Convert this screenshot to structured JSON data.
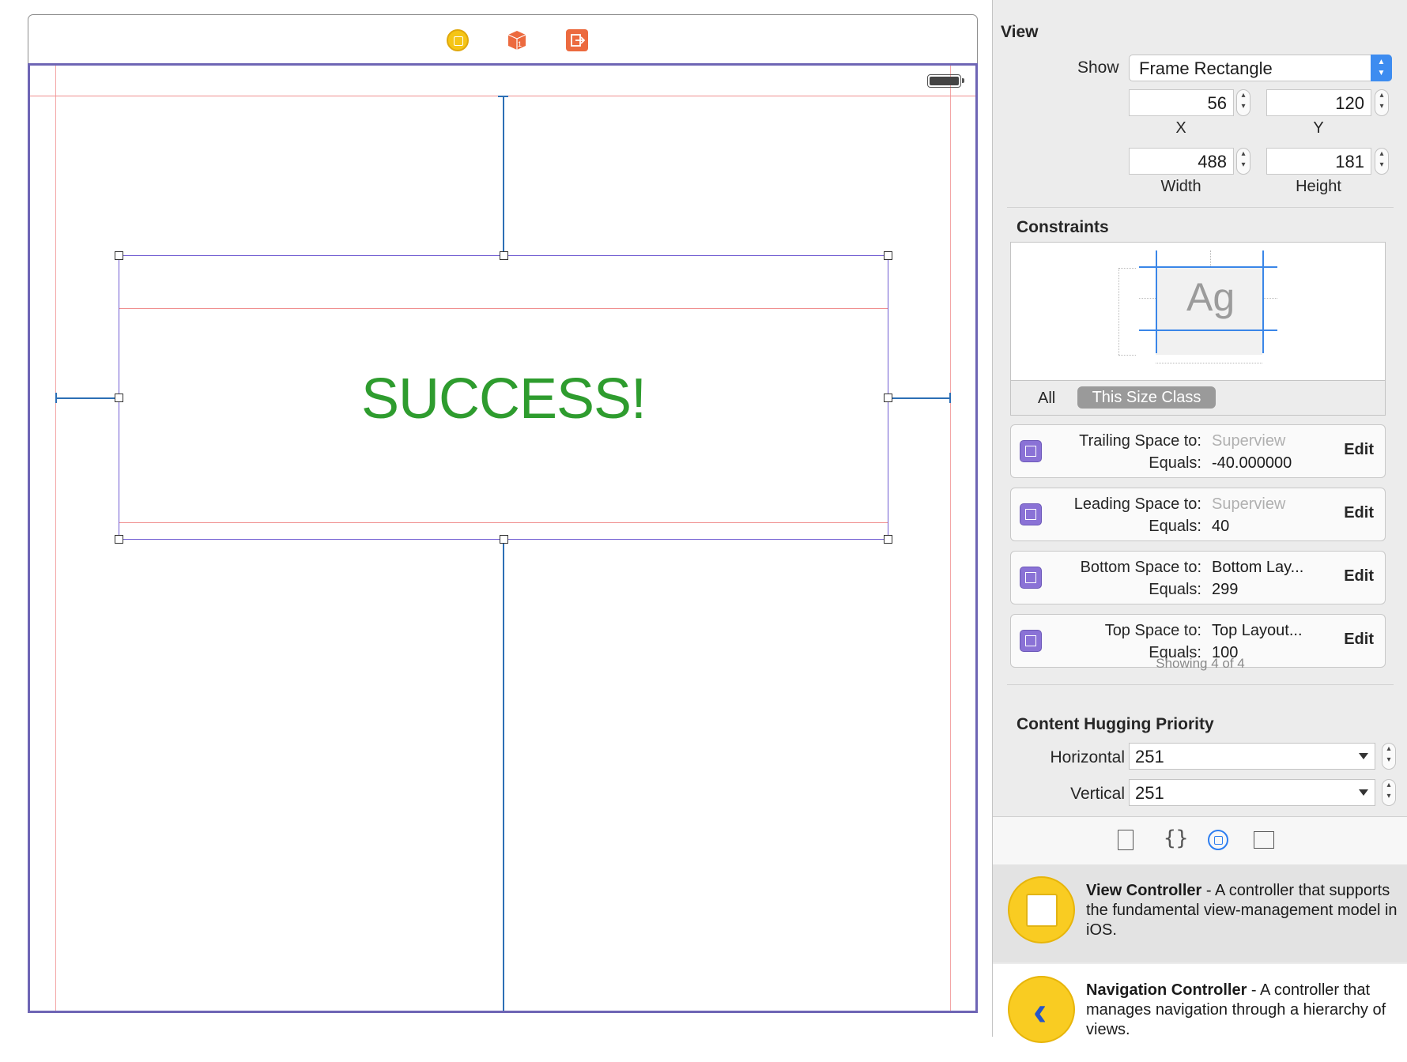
{
  "canvas": {
    "label_text": "SUCCESS!",
    "label_color": "#2e9c2e",
    "dock_icons": [
      "view-controller-icon",
      "first-responder-icon",
      "exit-icon"
    ]
  },
  "inspector": {
    "view_section": {
      "title": "View",
      "show_label": "Show",
      "show_value": "Frame Rectangle",
      "x_value": "56",
      "y_value": "120",
      "width_value": "488",
      "height_value": "181",
      "x_label": "X",
      "y_label": "Y",
      "width_label": "Width",
      "height_label": "Height"
    },
    "constraints_section": {
      "title": "Constraints",
      "preview_text": "Ag",
      "tab_all": "All",
      "tab_this_size_class": "This Size Class",
      "rows": [
        {
          "key1": "Trailing Space to:",
          "val1": "Superview",
          "key2": "Equals:",
          "val2": "-40.000000",
          "edit": "Edit"
        },
        {
          "key1": "Leading Space to:",
          "val1": "Superview",
          "key2": "Equals:",
          "val2": "40",
          "edit": "Edit"
        },
        {
          "key1": "Bottom Space to:",
          "val1": "Bottom Lay...",
          "key2": "Equals:",
          "val2": "299",
          "edit": "Edit"
        },
        {
          "key1": "Top Space to:",
          "val1": "Top Layout...",
          "key2": "Equals:",
          "val2": "100",
          "edit": "Edit"
        }
      ],
      "showing": "Showing 4 of 4"
    },
    "hugging_section": {
      "title": "Content Hugging Priority",
      "horizontal_label": "Horizontal",
      "horizontal_value": "251",
      "vertical_label": "Vertical",
      "vertical_value": "251"
    }
  },
  "library": {
    "tabs": [
      "file-template-icon",
      "code-snippet-icon",
      "object-library-icon",
      "media-library-icon"
    ],
    "items": [
      {
        "name": "View Controller",
        "desc": " - A controller that supports the fundamental view-management model in iOS."
      },
      {
        "name": "Navigation Controller",
        "desc": " - A controller that manages navigation through a hierarchy of views."
      }
    ]
  },
  "colors": {
    "accent": "#3a86e8",
    "constraint_purple": "#8a72d6",
    "library_yellow": "#f9cc22"
  }
}
